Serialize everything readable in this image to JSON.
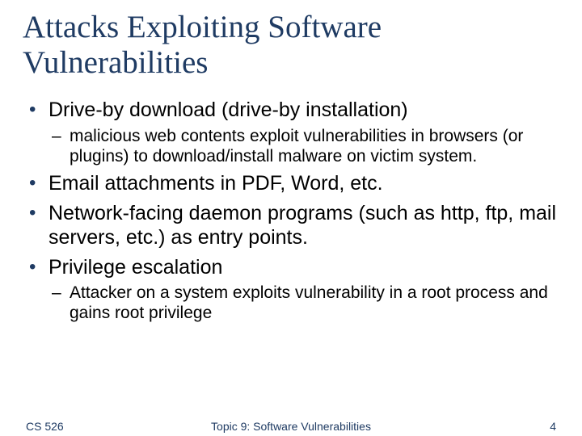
{
  "title": "Attacks Exploiting Software Vulnerabilities",
  "bullets": [
    {
      "text": "Drive-by download (drive-by installation)",
      "sub": [
        "malicious web contents exploit vulnerabilities in browsers (or plugins) to download/install malware on victim system."
      ]
    },
    {
      "text": "Email attachments in PDF, Word, etc.",
      "sub": []
    },
    {
      "text": "Network-facing daemon programs (such as http, ftp, mail servers, etc.) as entry points.",
      "sub": []
    },
    {
      "text": "Privilege escalation",
      "sub": [
        "Attacker on a system exploits vulnerability in a root process and gains root privilege"
      ]
    }
  ],
  "footer": {
    "left": "CS 526",
    "center": "Topic 9: Software Vulnerabilities",
    "right": "4"
  }
}
